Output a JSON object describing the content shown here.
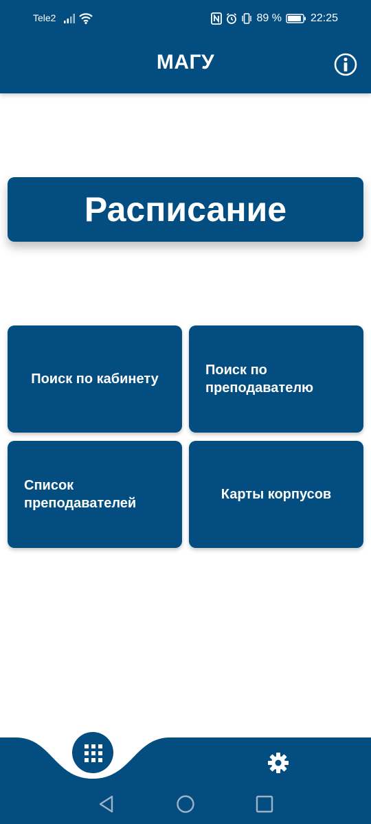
{
  "status_bar": {
    "carrier": "Tele2",
    "battery_text": "89 %",
    "time": "22:25",
    "icons": [
      "signal-icon",
      "wifi-icon",
      "nfc-icon",
      "alarm-icon",
      "vibrate-icon",
      "battery-icon"
    ]
  },
  "app_bar": {
    "title": "МАГУ",
    "info_icon": "info-icon"
  },
  "main": {
    "schedule_label": "Расписание",
    "tiles": [
      {
        "label": "Поиск по кабинету"
      },
      {
        "label": "Поиск по преподавателю"
      },
      {
        "label": "Список преподавателей"
      },
      {
        "label": "Карты корпусов"
      }
    ]
  },
  "bottom_nav": {
    "items": [
      "menu-grid-icon",
      "settings-gear-icon"
    ]
  },
  "system_nav": {
    "items": [
      "back-icon",
      "home-icon",
      "recent-apps-icon"
    ]
  },
  "colors": {
    "primary": "#034d80",
    "background": "#ffffff",
    "text_on_primary": "#ffffff"
  }
}
